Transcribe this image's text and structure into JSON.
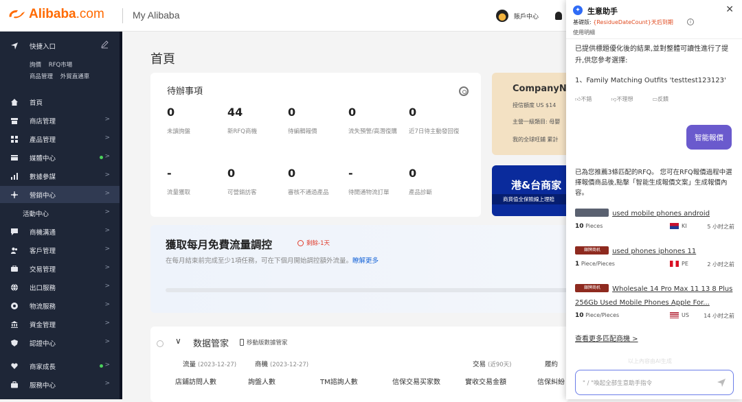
{
  "header": {
    "logo_text": "Alibaba",
    "logo_domain": ".com",
    "app_title": "My Alibaba",
    "account_label": "賬戶中心"
  },
  "sidebar": {
    "quick_entry": "快捷入口",
    "quick_links_row1": [
      "詢價",
      "RFQ市場"
    ],
    "quick_links_row2": [
      "商品管理",
      "外貿直通車"
    ],
    "items": [
      {
        "label": "首頁",
        "icon": "home-icon"
      },
      {
        "label": "商店管理",
        "icon": "store-icon"
      },
      {
        "label": "產品管理",
        "icon": "grid-icon"
      },
      {
        "label": "媒體中心",
        "icon": "media-icon"
      },
      {
        "label": "數據參謀",
        "icon": "bar-chart-icon"
      },
      {
        "label": "營銷中心",
        "icon": "marketing-icon"
      },
      {
        "label": "活動中心",
        "icon": ""
      },
      {
        "label": "商機溝通",
        "icon": "chat-icon"
      },
      {
        "label": "客戶管理",
        "icon": "users-icon"
      },
      {
        "label": "交易管理",
        "icon": "trade-icon"
      },
      {
        "label": "出口服務",
        "icon": "globe-icon"
      },
      {
        "label": "物流服務",
        "icon": "logistics-icon"
      },
      {
        "label": "資金管理",
        "icon": "bank-icon"
      },
      {
        "label": "認證中心",
        "icon": "shield-icon"
      },
      {
        "label": "商家成長",
        "icon": "heart-icon"
      },
      {
        "label": "服務中心",
        "icon": "briefcase-icon"
      }
    ]
  },
  "main": {
    "page_title": "首頁",
    "todo": {
      "title": "待辦事項",
      "stats": [
        {
          "value": "0",
          "label": "未讀詢盤"
        },
        {
          "value": "44",
          "label": "新RFQ商機"
        },
        {
          "value": "0",
          "label": "待編輯報價"
        },
        {
          "value": "0",
          "label": "流失預警/高潛復購"
        },
        {
          "value": "0",
          "label": "近7日待主動發回復"
        },
        {
          "value": "-",
          "label": "流量獲取"
        },
        {
          "value": "0",
          "label": "可營銷訪客"
        },
        {
          "value": "0",
          "label": "審核不通過產品"
        },
        {
          "value": "-",
          "label": "待開通物流訂單"
        },
        {
          "value": "0",
          "label": "產品診斷"
        }
      ]
    },
    "company": {
      "name": "CompanyN...",
      "credit": "授信額度 US $14",
      "category": "主營一級類目: 母嬰",
      "links": "我的全球旺鋪   累計"
    },
    "banner": {
      "title": "港&台商家",
      "subtitle": "商貨值全保險線上理賠"
    },
    "promo": {
      "title": "獲取每月免費流量調控",
      "badge": "剩餘-1天",
      "desc": "在每月結束前完成至少1項任務，可在下個月開始調控額外流量。",
      "link": "瞭解更多"
    },
    "data": {
      "title": "数据管家",
      "mobile": "移動版數據管家",
      "groups": [
        {
          "label": "流量",
          "date": "(2023-12-27)"
        },
        {
          "label": "商機",
          "date": "(2023-12-27)"
        },
        {
          "label": "交易",
          "date": "(近90天)"
        },
        {
          "label": "履約",
          "date": ""
        }
      ],
      "columns": [
        "店鋪訪問人數",
        "詢盤人數",
        "TM諮詢人數",
        "信保交易买家数",
        "實收交易金額",
        "信保糾紛"
      ]
    }
  },
  "assistant": {
    "title": "生意助手",
    "plan_prefix": "基礎版: ",
    "plan_highlight": "{ResidueDateCount}天后到期",
    "help": "使用明細",
    "msg1": "已提供標題優化後的結果,並對整體可讀性進行了提升,供您參考選擇:",
    "msg1_item": "1、Family Matching Outfits 'testtest123123'",
    "feedback": [
      "不錯",
      "不理想",
      "反饋"
    ],
    "action_button": "智能報價",
    "msg2": "已為您推薦3條匹配的RFQ。 您可在RFQ報價過程中選擇報價商品後,點擊「智能生成報價文案」生成報價內容。",
    "rfqs": [
      {
        "badge": "",
        "title": "used mobile phones android",
        "qty": "10",
        "unit": "Pieces",
        "country": "KI",
        "ago": "5 小时之前",
        "flag_color": "#c8102e"
      },
      {
        "badge": "銀牌商机",
        "title": "used phones iphones 11",
        "qty": "1",
        "unit": "Piece/Pieces",
        "country": "PE",
        "ago": "2 小时之前",
        "flag_color": "#d91023"
      },
      {
        "badge": "銀牌商机",
        "title": "Wholesale 14 Pro Max 11 13 8 Plus 256Gb Used Mobile Phones Apple For...",
        "qty": "10",
        "unit": "Piece/Pieces",
        "country": "US",
        "ago": "14 小时之前",
        "flag_color": "#3c3b6e"
      }
    ],
    "more_link": "查看更多匹配商機 >",
    "faded_text": "以上內容由AI生成",
    "input_placeholder": "\" / \"喚起全部生意助手指令"
  }
}
